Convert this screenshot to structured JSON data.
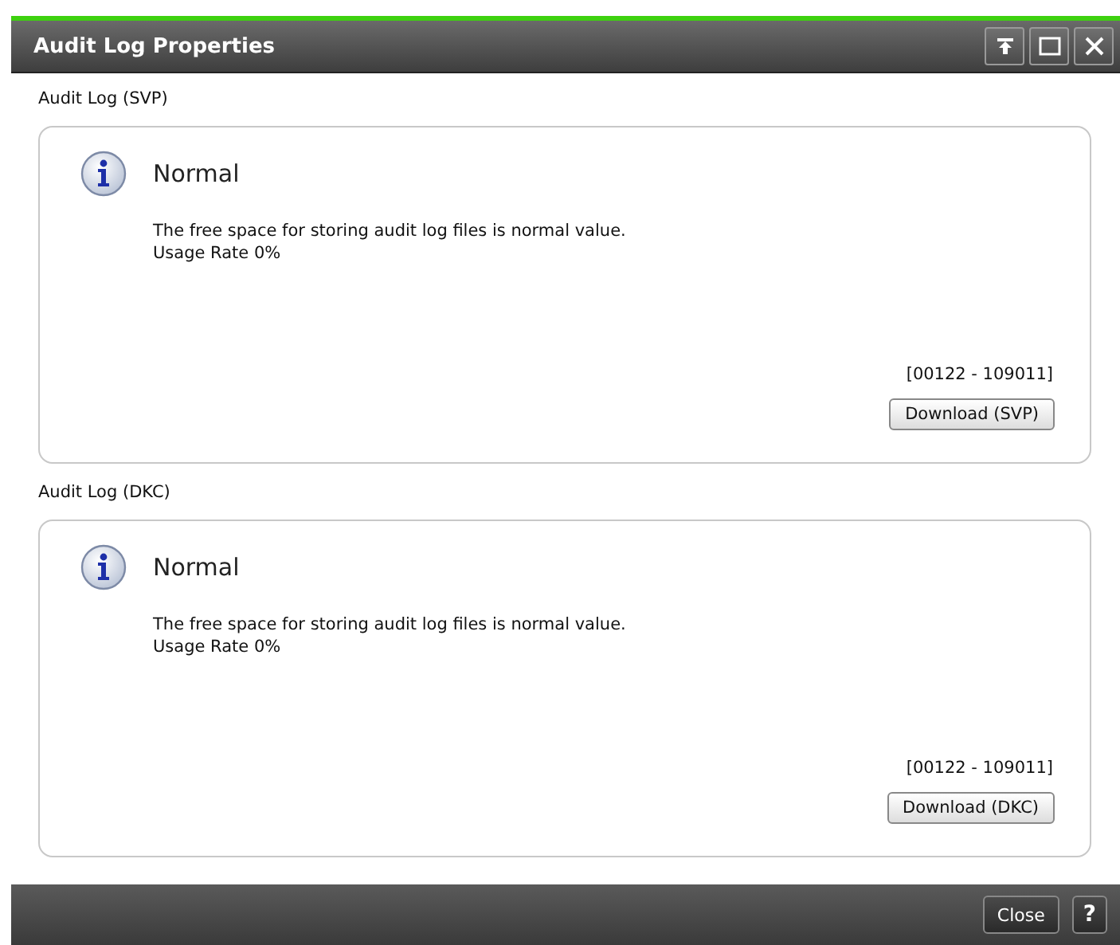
{
  "window": {
    "title": "Audit Log Properties"
  },
  "sections": [
    {
      "label": "Audit Log (SVP)",
      "status": "Normal",
      "message": "The free space for storing audit log files is normal value.",
      "usage": "Usage Rate 0%",
      "range": "[00122 - 109011]",
      "button": "Download (SVP)"
    },
    {
      "label": "Audit Log (DKC)",
      "status": "Normal",
      "message": "The free space for storing audit log files is normal value.",
      "usage": "Usage Rate 0%",
      "range": "[00122 - 109011]",
      "button": "Download (DKC)"
    }
  ],
  "footer": {
    "close": "Close",
    "help": "?"
  }
}
